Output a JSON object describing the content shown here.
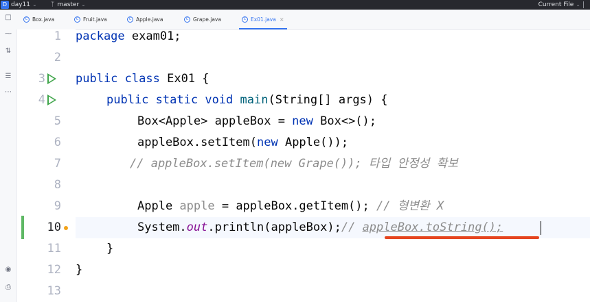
{
  "titlebar": {
    "project_badge": "D",
    "project_name": "day11",
    "branch_icon": "branch-icon",
    "branch": "master",
    "run_config": "Current File"
  },
  "tabs": [
    {
      "label": "Box.java",
      "icon": "class-icon",
      "active": false
    },
    {
      "label": "Fruit.java",
      "icon": "class-icon",
      "active": false
    },
    {
      "label": "Apple.java",
      "icon": "class-icon",
      "active": false
    },
    {
      "label": "Grape.java",
      "icon": "class-icon",
      "active": false
    },
    {
      "label": "Ex01.java",
      "icon": "class-icon",
      "active": true,
      "close": "×"
    }
  ],
  "toolstrip": [
    "project-icon",
    "commit-icon",
    "pull-requests-icon",
    "structure-icon",
    "more-icon",
    "services-icon",
    "terminal-icon"
  ],
  "editor": {
    "current_line": 10,
    "line_numbers": [
      "1",
      "2",
      "3",
      "4",
      "5",
      "6",
      "7",
      "8",
      "9",
      "10",
      "11",
      "12",
      "13"
    ],
    "lines": {
      "l1": {
        "kw": "package",
        "rest": " exam01;"
      },
      "l3": {
        "kw1": "public",
        "kw2": "class",
        "rest": " Ex01 {"
      },
      "l4": {
        "kw1": "public",
        "kw2": "static",
        "kw3": "void",
        "fn": "main",
        "rest": "(String[] args) {"
      },
      "l5": {
        "a": "Box<Apple> appleBox = ",
        "kw": "new",
        "b": " Box<>();"
      },
      "l6": {
        "a": "appleBox.setItem(",
        "kw": "new",
        "b": " Apple());"
      },
      "l7": {
        "comment": "// appleBox.setItem(new Grape()); 타입 안정성 확보"
      },
      "l9": {
        "a": "Apple ",
        "unused": "apple",
        "b": " = appleBox.getItem(); ",
        "comment": "// 형변환 X"
      },
      "l10": {
        "a": "System.",
        "field": "out",
        "b": ".println(appleBox);",
        "comment_prefix": "// ",
        "comment_rest": "appleBox.toString();"
      },
      "l11": {
        "text": "}"
      },
      "l12": {
        "text": "}"
      }
    }
  }
}
